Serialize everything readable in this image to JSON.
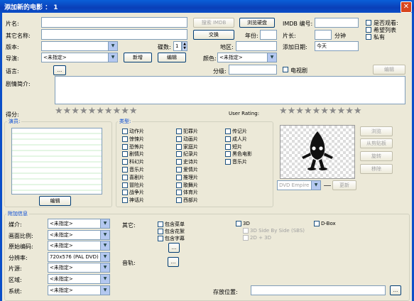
{
  "window": {
    "title": "添加新的电影 ： 1"
  },
  "fields": {
    "title_label": "片名:",
    "search_imdb": "搜索 IMDB",
    "browse_disk": "浏览硬盘",
    "imdb_no": "IMDB 编号:",
    "other_names_label": "其它名称:",
    "swap": "交换",
    "year_label": "年份:",
    "length_label": "片长:",
    "minutes": "分钟",
    "version_label": "版本:",
    "discs_label": "碟数:",
    "discs_value": "1",
    "region_label": "地区:",
    "added_label": "添加日期:",
    "added_value": "今天",
    "director_label": "导演:",
    "unspecified": "<未指定>",
    "new": "新增",
    "edit": "编辑",
    "color_label": "颜色:",
    "language_label": "语言:",
    "ellipsis": "...",
    "rating_label": "分级:",
    "tv_series": "电视剧",
    "edit2": "编辑",
    "plot_label": "剧情简介:",
    "score_label": "得分:",
    "user_rating_label": "User Rating:",
    "seen": "是否观看:",
    "wishlist": "希望列表",
    "private": "私有"
  },
  "actors": {
    "title": "演员:",
    "edit": "编辑"
  },
  "genres": {
    "title": "类型:",
    "col1": [
      "动作片",
      "惊悚片",
      "恐怖片",
      "剧情片",
      "科幻片",
      "音乐片",
      "喜剧片",
      "冒险片",
      "战争片",
      "神话片"
    ],
    "col2": [
      "犯罪片",
      "动画片",
      "家庭片",
      "纪录片",
      "史诗片",
      "爱情片",
      "推理片",
      "歌舞片",
      "体育片",
      "西部片"
    ],
    "col3": [
      "传记片",
      "成人片",
      "短片",
      "黑色电影",
      "音乐片"
    ]
  },
  "cover": {
    "browse": "浏览",
    "from_clipboard": "从剪贴板",
    "rotate": "旋转",
    "remove": "移除",
    "source": "DVD Empire",
    "update": "更新"
  },
  "extra": {
    "title": "附加信息",
    "rows": [
      {
        "label": "媒介:",
        "value": "<未指定>"
      },
      {
        "label": "画面比例:",
        "value": "<未指定>"
      },
      {
        "label": "原始编码:",
        "value": "<未指定>"
      },
      {
        "label": "分辨率:",
        "value": "720x576 (PAL DVD)"
      },
      {
        "label": "片源:",
        "value": "<未指定>"
      },
      {
        "label": "区域:",
        "value": "<未指定>"
      },
      {
        "label": "系统:",
        "value": "<未指定>"
      }
    ],
    "other_label": "其它:",
    "other_opts": [
      "包含菜单",
      "包含花絮",
      "包含字幕"
    ],
    "audio_label": "音轨:",
    "opt_3d": "3D",
    "opt_3d_sbs": "3D Side By Side (SBS)",
    "opt_2d3d": "2D + 3D",
    "dbox": "D-Box",
    "storage_label": "存放位置:"
  },
  "colors": {
    "titlebar": "#0a4fc8",
    "section": "#0046d5"
  }
}
